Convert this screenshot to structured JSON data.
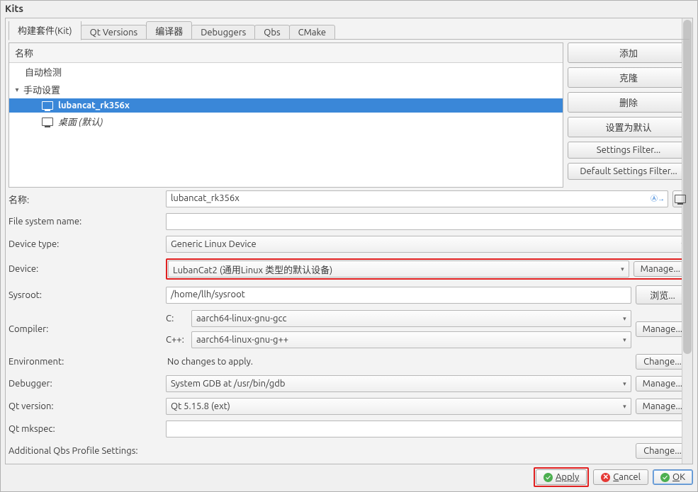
{
  "window": {
    "title": "Kits"
  },
  "tabs": [
    "构建套件(Kit)",
    "Qt Versions",
    "编译器",
    "Debuggers",
    "Qbs",
    "CMake"
  ],
  "tree": {
    "header": "名称",
    "group_auto": "自动检测",
    "group_manual": "手动设置",
    "item_selected": "lubancat_rk356x",
    "item_default": "桌面 (默认)"
  },
  "side_buttons": {
    "add": "添加",
    "clone": "克隆",
    "delete": "删除",
    "make_default": "设置为默认",
    "settings_filter": "Settings Filter...",
    "default_settings_filter": "Default Settings Filter..."
  },
  "form": {
    "name_label": "名称:",
    "name_value": "lubancat_rk356x",
    "fs_label": "File system name:",
    "fs_value": "",
    "devtype_label": "Device type:",
    "devtype_value": "Generic Linux Device",
    "device_label": "Device:",
    "device_value": "LubanCat2 (通用Linux 类型的默认设备)",
    "device_manage": "Manage...",
    "sysroot_label": "Sysroot:",
    "sysroot_value": "/home/llh/sysroot",
    "sysroot_browse": "浏览...",
    "compiler_label": "Compiler:",
    "compiler_c_label": "C:",
    "compiler_c_value": "aarch64-linux-gnu-gcc",
    "compiler_cpp_label": "C++:",
    "compiler_cpp_value": "aarch64-linux-gnu-g++",
    "compiler_manage": "Manage...",
    "env_label": "Environment:",
    "env_text": "No changes to apply.",
    "env_change": "Change...",
    "debugger_label": "Debugger:",
    "debugger_value": "System GDB at /usr/bin/gdb",
    "debugger_manage": "Manage...",
    "qtver_label": "Qt version:",
    "qtver_value": "Qt 5.15.8 (ext)",
    "qtver_manage": "Manage...",
    "mkspec_label": "Qt mkspec:",
    "mkspec_value": "",
    "qbs_label": "Additional Qbs Profile Settings:",
    "qbs_change": "Change..."
  },
  "bottom": {
    "apply": "Apply",
    "cancel": "Cancel",
    "ok": "OK"
  }
}
